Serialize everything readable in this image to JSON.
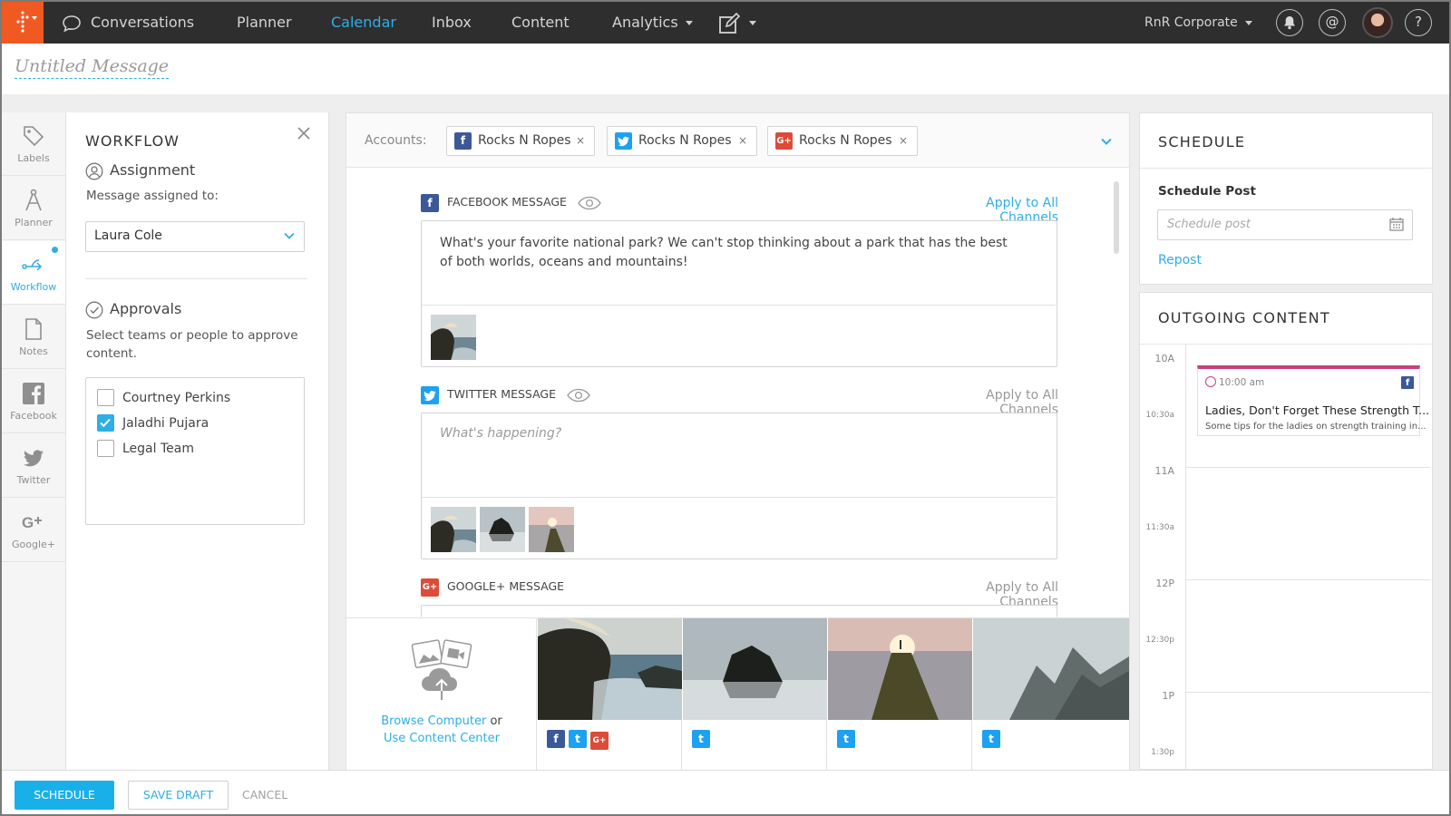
{
  "nav": {
    "items": [
      {
        "label": "Conversations"
      },
      {
        "label": "Planner"
      },
      {
        "label": "Calendar"
      },
      {
        "label": "Inbox"
      },
      {
        "label": "Content"
      },
      {
        "label": "Analytics"
      }
    ],
    "active_item": "Calendar",
    "account_selector": "RnR Corporate",
    "help_label": "?",
    "mentions_label": "@"
  },
  "message": {
    "title": "Untitled Message"
  },
  "rail": {
    "items": [
      {
        "label": "Labels",
        "icon": "tag-icon"
      },
      {
        "label": "Planner",
        "icon": "compass-icon"
      },
      {
        "label": "Workflow",
        "icon": "workflow-icon"
      },
      {
        "label": "Notes",
        "icon": "document-icon"
      },
      {
        "label": "Facebook",
        "icon": "facebook-icon"
      },
      {
        "label": "Twitter",
        "icon": "twitter-icon"
      },
      {
        "label": "Google+",
        "icon": "googleplus-icon"
      }
    ],
    "active": "Workflow"
  },
  "workflow": {
    "title": "WORKFLOW",
    "assignment_heading": "Assignment",
    "assigned_label": "Message assigned to:",
    "assignee": "Laura Cole",
    "approvals_heading": "Approvals",
    "approvals_help": "Select teams or people to approve content.",
    "approvers": [
      {
        "name": "Courtney Perkins",
        "checked": false
      },
      {
        "name": "Jaladhi Pujara",
        "checked": true
      },
      {
        "name": "Legal Team",
        "checked": false
      }
    ]
  },
  "composer": {
    "accounts_label": "Accounts:",
    "accounts": [
      {
        "network": "facebook",
        "name": "Rocks N Ropes",
        "remove": "×"
      },
      {
        "network": "twitter",
        "name": "Rocks N Ropes",
        "remove": "×"
      },
      {
        "network": "googleplus",
        "name": "Rocks N Ropes",
        "remove": "×"
      }
    ],
    "apply_all_label": "Apply to All Channels",
    "facebook": {
      "heading": "FACEBOOK MESSAGE",
      "text": "What's your favorite national park? We can't stop thinking about a park that has the best of both worlds, oceans and mountains!"
    },
    "twitter": {
      "heading": "TWITTER MESSAGE",
      "placeholder": "What's happening?"
    },
    "googleplus": {
      "heading": "GOOGLE+ MESSAGE"
    }
  },
  "media_tray": {
    "browse_label": "Browse Computer",
    "or_label": "or",
    "content_center_label": "Use Content Center"
  },
  "schedule": {
    "title": "SCHEDULE",
    "label": "Schedule Post",
    "placeholder": "Schedule post",
    "repost_label": "Repost"
  },
  "outgoing": {
    "title": "OUTGOING CONTENT",
    "times": [
      "10A",
      "10:30a",
      "11A",
      "11:30a",
      "12P",
      "12:30p",
      "1P",
      "1:30p"
    ],
    "event": {
      "time": "10:00 am",
      "title": "Ladies, Don't Forget These Strength T...",
      "subtitle": "Some tips for the ladies on strength training in..."
    }
  },
  "footer": {
    "schedule_button": "SCHEDULE",
    "save_draft_button": "SAVE DRAFT",
    "cancel_button": "CANCEL"
  },
  "colors": {
    "accent": "#2eaee6",
    "brand_orange": "#f05a22",
    "nav_bg": "#2e2e2e",
    "event_accent": "#c8417d",
    "facebook": "#3b5998",
    "twitter": "#1da1f2",
    "googleplus": "#dd4b39"
  }
}
